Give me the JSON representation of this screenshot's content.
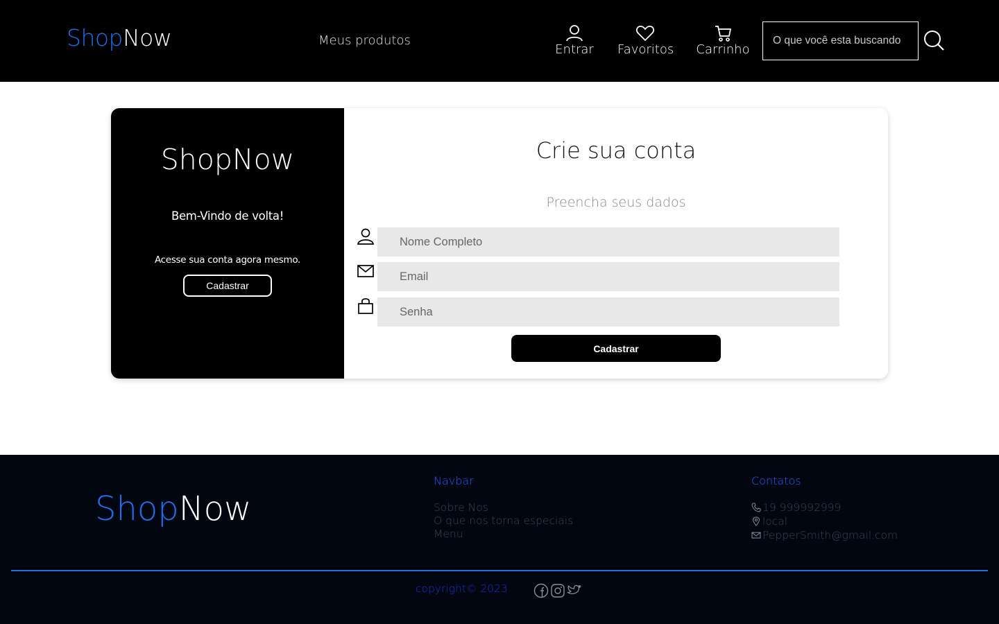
{
  "header": {
    "logo_part1": "Shop",
    "logo_part2": "Now",
    "nav_link": "Meus produtos",
    "login_label": "Entrar",
    "favorites_label": "Favoritos",
    "cart_label": "Carrinho",
    "search_placeholder": "O que você esta buscando"
  },
  "card_left": {
    "brand": "ShopNow",
    "welcome": "Bem-Vindo de volta!",
    "access_text": "Acesse sua conta agora mesmo.",
    "button_label": "Cadastrar"
  },
  "form": {
    "title": "Crie sua conta",
    "subtitle": "Preencha seus dados",
    "name_placeholder": "Nome Completo",
    "email_placeholder": "Email",
    "password_placeholder": "Senha",
    "submit_label": "Cadastrar"
  },
  "footer": {
    "logo_part1": "Shop",
    "logo_part2": "Now",
    "navbar_title": "Navbar",
    "navbar_links": [
      "Sobre Nos",
      "O que nos torna especiais",
      "Menu"
    ],
    "contacts_title": "Contatos",
    "phone": "19 999992999",
    "location": " local",
    "email": "PepperSmith@gmail.com",
    "copyright": "copyright© 2023"
  },
  "colors": {
    "accent": "#1f6feb",
    "header_bg": "#000000",
    "footer_bg": "#020611"
  },
  "icons": [
    "user-icon",
    "heart-icon",
    "cart-icon",
    "search-icon",
    "mail-icon",
    "lock-icon",
    "phone-icon",
    "location-icon",
    "facebook-icon",
    "instagram-icon",
    "twitter-icon"
  ]
}
